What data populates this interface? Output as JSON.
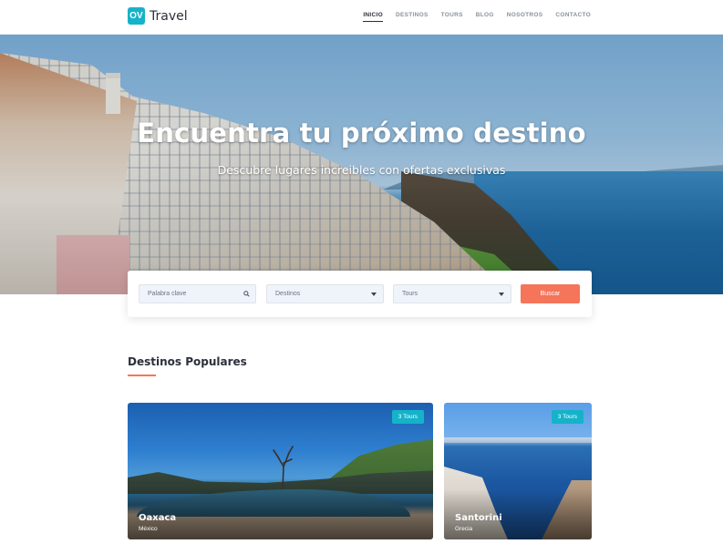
{
  "header": {
    "logo_mark": "OV",
    "logo_text": "Travel",
    "nav": [
      {
        "label": "INICIO",
        "active": true
      },
      {
        "label": "DESTINOS",
        "active": false
      },
      {
        "label": "TOURS",
        "active": false
      },
      {
        "label": "BLOG",
        "active": false
      },
      {
        "label": "NOSOTROS",
        "active": false
      },
      {
        "label": "CONTACTO",
        "active": false
      }
    ]
  },
  "hero": {
    "title": "Encuentra tu próximo destino",
    "subtitle": "Descubre lugares increibles con ofertas exclusivas"
  },
  "search": {
    "keyword_placeholder": "Palabra clave",
    "keyword_icon": "search-icon",
    "destinations_value": "Destinos",
    "tours_value": "Tours",
    "button_label": "Buscar"
  },
  "popular": {
    "title": "Destinos Populares",
    "cards": [
      {
        "name": "Oaxaca",
        "country": "México",
        "badge": "3 Tours"
      },
      {
        "name": "Santorini",
        "country": "Grecia",
        "badge": "3 Tours"
      }
    ]
  },
  "colors": {
    "brand": "#15b3c9",
    "accent": "#f4755a",
    "text": "#2b2f3a"
  }
}
